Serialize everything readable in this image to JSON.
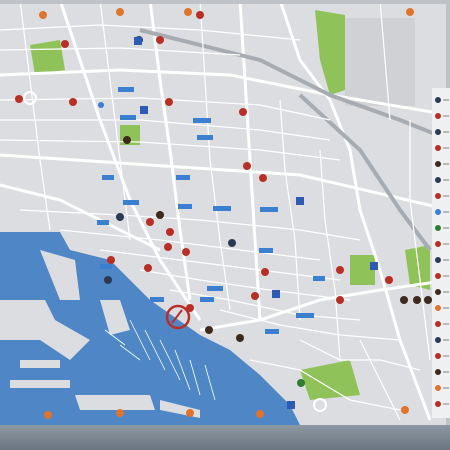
{
  "map": {
    "title": "",
    "water_color": "#4f86c6",
    "land_color": "#d8d9db",
    "road_color": "#ffffff",
    "park_color": "#8fc35a",
    "marker_color": "#b83025",
    "info_color": "#3b7fd1",
    "parking_color": "#2d5bb3"
  },
  "labels": [
    {
      "id": "l1",
      "text": "i"
    },
    {
      "id": "l2",
      "text": "i"
    },
    {
      "id": "l3",
      "text": "i"
    },
    {
      "id": "l4",
      "text": "i"
    },
    {
      "id": "l5",
      "text": "i"
    },
    {
      "id": "l6",
      "text": "i"
    },
    {
      "id": "l7",
      "text": "i"
    },
    {
      "id": "l8",
      "text": "i"
    },
    {
      "id": "l9",
      "text": "i"
    }
  ],
  "parking": {
    "symbol": "P"
  },
  "station": {
    "symbol": "🚉"
  },
  "legend": {
    "symbol": "●"
  }
}
